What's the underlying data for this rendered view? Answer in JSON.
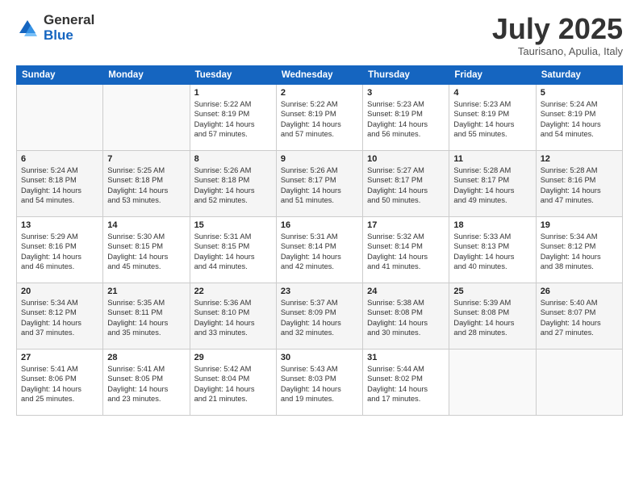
{
  "header": {
    "logo_general": "General",
    "logo_blue": "Blue",
    "month_title": "July 2025",
    "subtitle": "Taurisano, Apulia, Italy"
  },
  "days_of_week": [
    "Sunday",
    "Monday",
    "Tuesday",
    "Wednesday",
    "Thursday",
    "Friday",
    "Saturday"
  ],
  "weeks": [
    [
      {
        "day": "",
        "lines": []
      },
      {
        "day": "",
        "lines": []
      },
      {
        "day": "1",
        "lines": [
          "Sunrise: 5:22 AM",
          "Sunset: 8:19 PM",
          "Daylight: 14 hours",
          "and 57 minutes."
        ]
      },
      {
        "day": "2",
        "lines": [
          "Sunrise: 5:22 AM",
          "Sunset: 8:19 PM",
          "Daylight: 14 hours",
          "and 57 minutes."
        ]
      },
      {
        "day": "3",
        "lines": [
          "Sunrise: 5:23 AM",
          "Sunset: 8:19 PM",
          "Daylight: 14 hours",
          "and 56 minutes."
        ]
      },
      {
        "day": "4",
        "lines": [
          "Sunrise: 5:23 AM",
          "Sunset: 8:19 PM",
          "Daylight: 14 hours",
          "and 55 minutes."
        ]
      },
      {
        "day": "5",
        "lines": [
          "Sunrise: 5:24 AM",
          "Sunset: 8:19 PM",
          "Daylight: 14 hours",
          "and 54 minutes."
        ]
      }
    ],
    [
      {
        "day": "6",
        "lines": [
          "Sunrise: 5:24 AM",
          "Sunset: 8:18 PM",
          "Daylight: 14 hours",
          "and 54 minutes."
        ]
      },
      {
        "day": "7",
        "lines": [
          "Sunrise: 5:25 AM",
          "Sunset: 8:18 PM",
          "Daylight: 14 hours",
          "and 53 minutes."
        ]
      },
      {
        "day": "8",
        "lines": [
          "Sunrise: 5:26 AM",
          "Sunset: 8:18 PM",
          "Daylight: 14 hours",
          "and 52 minutes."
        ]
      },
      {
        "day": "9",
        "lines": [
          "Sunrise: 5:26 AM",
          "Sunset: 8:17 PM",
          "Daylight: 14 hours",
          "and 51 minutes."
        ]
      },
      {
        "day": "10",
        "lines": [
          "Sunrise: 5:27 AM",
          "Sunset: 8:17 PM",
          "Daylight: 14 hours",
          "and 50 minutes."
        ]
      },
      {
        "day": "11",
        "lines": [
          "Sunrise: 5:28 AM",
          "Sunset: 8:17 PM",
          "Daylight: 14 hours",
          "and 49 minutes."
        ]
      },
      {
        "day": "12",
        "lines": [
          "Sunrise: 5:28 AM",
          "Sunset: 8:16 PM",
          "Daylight: 14 hours",
          "and 47 minutes."
        ]
      }
    ],
    [
      {
        "day": "13",
        "lines": [
          "Sunrise: 5:29 AM",
          "Sunset: 8:16 PM",
          "Daylight: 14 hours",
          "and 46 minutes."
        ]
      },
      {
        "day": "14",
        "lines": [
          "Sunrise: 5:30 AM",
          "Sunset: 8:15 PM",
          "Daylight: 14 hours",
          "and 45 minutes."
        ]
      },
      {
        "day": "15",
        "lines": [
          "Sunrise: 5:31 AM",
          "Sunset: 8:15 PM",
          "Daylight: 14 hours",
          "and 44 minutes."
        ]
      },
      {
        "day": "16",
        "lines": [
          "Sunrise: 5:31 AM",
          "Sunset: 8:14 PM",
          "Daylight: 14 hours",
          "and 42 minutes."
        ]
      },
      {
        "day": "17",
        "lines": [
          "Sunrise: 5:32 AM",
          "Sunset: 8:14 PM",
          "Daylight: 14 hours",
          "and 41 minutes."
        ]
      },
      {
        "day": "18",
        "lines": [
          "Sunrise: 5:33 AM",
          "Sunset: 8:13 PM",
          "Daylight: 14 hours",
          "and 40 minutes."
        ]
      },
      {
        "day": "19",
        "lines": [
          "Sunrise: 5:34 AM",
          "Sunset: 8:12 PM",
          "Daylight: 14 hours",
          "and 38 minutes."
        ]
      }
    ],
    [
      {
        "day": "20",
        "lines": [
          "Sunrise: 5:34 AM",
          "Sunset: 8:12 PM",
          "Daylight: 14 hours",
          "and 37 minutes."
        ]
      },
      {
        "day": "21",
        "lines": [
          "Sunrise: 5:35 AM",
          "Sunset: 8:11 PM",
          "Daylight: 14 hours",
          "and 35 minutes."
        ]
      },
      {
        "day": "22",
        "lines": [
          "Sunrise: 5:36 AM",
          "Sunset: 8:10 PM",
          "Daylight: 14 hours",
          "and 33 minutes."
        ]
      },
      {
        "day": "23",
        "lines": [
          "Sunrise: 5:37 AM",
          "Sunset: 8:09 PM",
          "Daylight: 14 hours",
          "and 32 minutes."
        ]
      },
      {
        "day": "24",
        "lines": [
          "Sunrise: 5:38 AM",
          "Sunset: 8:08 PM",
          "Daylight: 14 hours",
          "and 30 minutes."
        ]
      },
      {
        "day": "25",
        "lines": [
          "Sunrise: 5:39 AM",
          "Sunset: 8:08 PM",
          "Daylight: 14 hours",
          "and 28 minutes."
        ]
      },
      {
        "day": "26",
        "lines": [
          "Sunrise: 5:40 AM",
          "Sunset: 8:07 PM",
          "Daylight: 14 hours",
          "and 27 minutes."
        ]
      }
    ],
    [
      {
        "day": "27",
        "lines": [
          "Sunrise: 5:41 AM",
          "Sunset: 8:06 PM",
          "Daylight: 14 hours",
          "and 25 minutes."
        ]
      },
      {
        "day": "28",
        "lines": [
          "Sunrise: 5:41 AM",
          "Sunset: 8:05 PM",
          "Daylight: 14 hours",
          "and 23 minutes."
        ]
      },
      {
        "day": "29",
        "lines": [
          "Sunrise: 5:42 AM",
          "Sunset: 8:04 PM",
          "Daylight: 14 hours",
          "and 21 minutes."
        ]
      },
      {
        "day": "30",
        "lines": [
          "Sunrise: 5:43 AM",
          "Sunset: 8:03 PM",
          "Daylight: 14 hours",
          "and 19 minutes."
        ]
      },
      {
        "day": "31",
        "lines": [
          "Sunrise: 5:44 AM",
          "Sunset: 8:02 PM",
          "Daylight: 14 hours",
          "and 17 minutes."
        ]
      },
      {
        "day": "",
        "lines": []
      },
      {
        "day": "",
        "lines": []
      }
    ]
  ]
}
